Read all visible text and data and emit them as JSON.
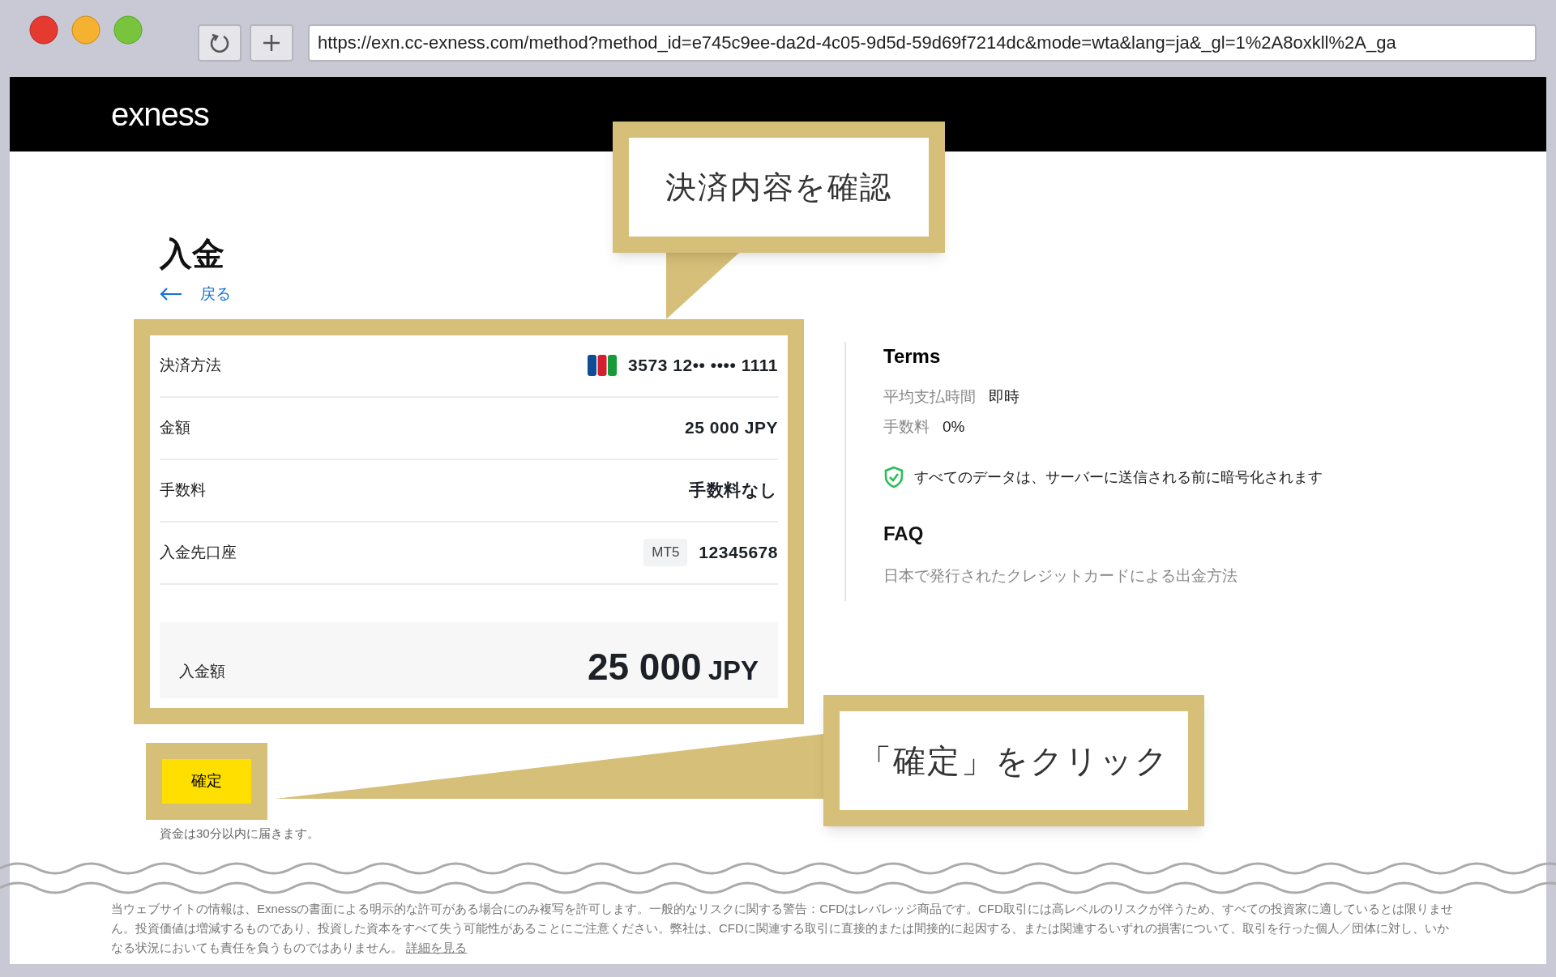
{
  "browser": {
    "url": "https://exn.cc-exness.com/method?method_id=e745c9ee-da2d-4c05-9d5d-59d69f7214dc&mode=wta&lang=ja&_gl=1%2A8oxkll%2A_ga"
  },
  "header": {
    "logo": "exness"
  },
  "callouts": [
    {
      "text": "決済内容を確認"
    },
    {
      "text": "「確定」をクリック"
    }
  ],
  "page": {
    "title": "入金",
    "back_link": "戻る"
  },
  "summary": {
    "rows": [
      {
        "kind": "card",
        "label": "決済方法",
        "value": "3573 12•• •••• 1111"
      },
      {
        "kind": "plain",
        "label": "金額",
        "value": "25 000 JPY"
      },
      {
        "kind": "plain",
        "label": "手数料",
        "value": "手数料なし"
      },
      {
        "kind": "account",
        "label": "入金先口座",
        "badge": "MT5",
        "value": "12345678"
      }
    ],
    "total": {
      "label": "入金額",
      "amount": "25 000",
      "currency": "JPY"
    }
  },
  "confirm_button": "確定",
  "note": "資金は30分以内に届きます。",
  "terms": {
    "title": "Terms",
    "items": [
      {
        "label": "平均支払時間",
        "value": "即時"
      },
      {
        "label": "手数料",
        "value": "0%"
      }
    ],
    "security_note": "すべてのデータは、サーバーに送信される前に暗号化されます"
  },
  "faq": {
    "title": "FAQ",
    "links": [
      "日本で発行されたクレジットカードによる出金方法"
    ]
  },
  "footer": {
    "disclaimer": "当ウェブサイトの情報は、Exnessの書面による明示的な許可がある場合にのみ複写を許可します。一般的なリスクに関する警告：CFDはレバレッジ商品です。CFD取引には高レベルのリスクが伴うため、すべての投資家に適しているとは限りません。投資価値は増減するものであり、投資した資本をすべて失う可能性があることにご注意ください。弊社は、CFDに関連する取引に直接的または間接的に起因する、または関連するいずれの損害について、取引を行った個人／団体に対し、いかなる状況においても責任を負うものではありません。",
    "link": "詳細を見る"
  }
}
